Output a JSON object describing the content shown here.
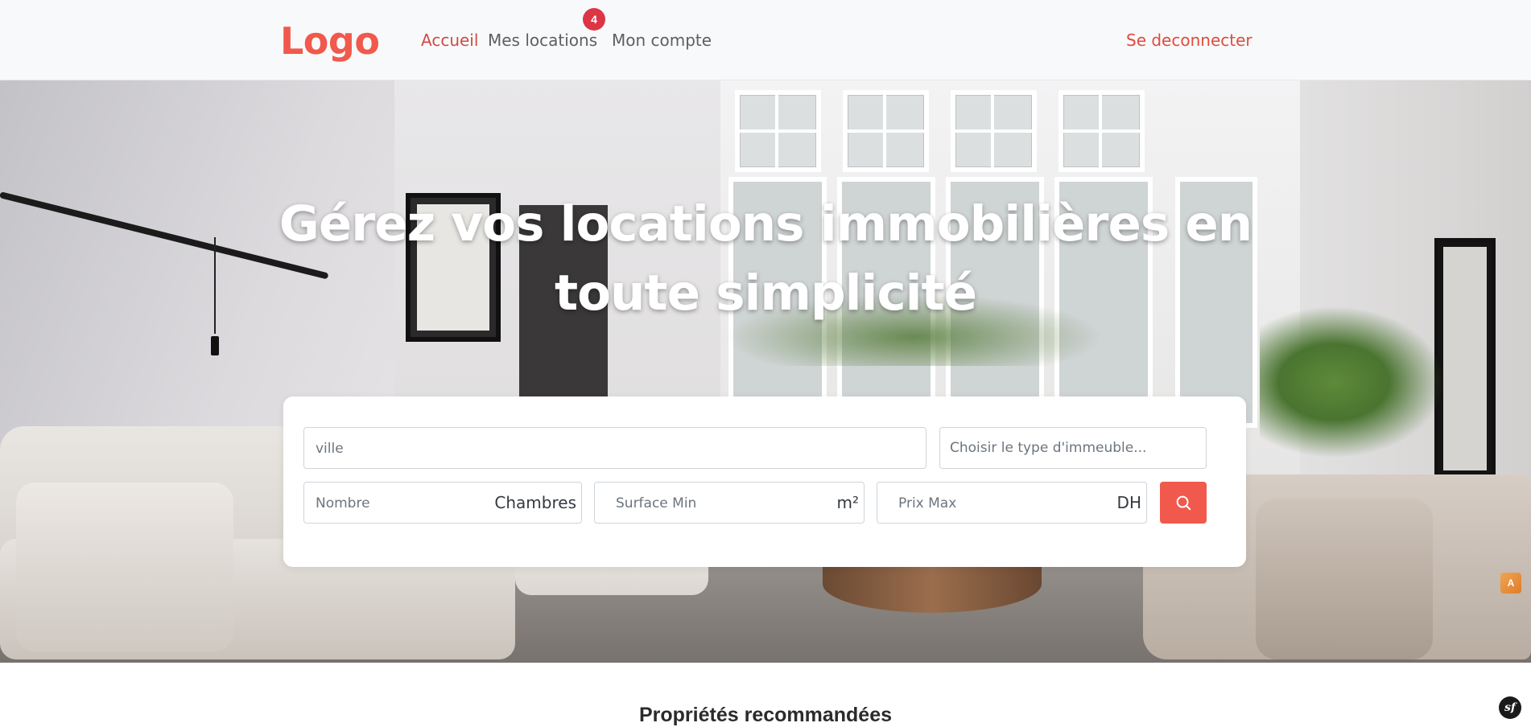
{
  "navbar": {
    "logo": "Logo",
    "links": [
      {
        "label": "Accueil",
        "active": true
      },
      {
        "label": "Mes locations",
        "badge": "4"
      },
      {
        "label": "Mon compte"
      }
    ],
    "logout_label": "Se deconnecter"
  },
  "hero": {
    "title": "Gérez vos locations immobilières en toute simplicité"
  },
  "search": {
    "city_placeholder": "ville",
    "type_placeholder": "Choisir le type d'immeuble...",
    "rooms_placeholder": "Nombre",
    "rooms_unit": "Chambres",
    "surface_placeholder": "Surface Min",
    "surface_unit": "m²",
    "price_placeholder": "Prix Max",
    "price_unit": "DH",
    "button_icon": "search-icon"
  },
  "section": {
    "title": "Propriétés recommandées"
  },
  "widgets": {
    "translate_icon": "translate-icon",
    "symfony_icon": "symfony-debug-icon",
    "symfony_text": "sf"
  },
  "colors": {
    "brand": "#f0594c",
    "active_link": "#d04b45",
    "badge": "#dc3545",
    "navbar_bg": "#f8f9fa"
  }
}
